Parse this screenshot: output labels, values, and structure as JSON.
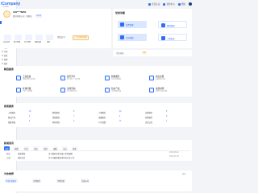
{
  "brand": {
    "logo": "iCompany",
    "sub": "企业服务"
  },
  "sidebar": {
    "items": [
      {
        "label": "首页"
      },
      {
        "label": "我的企业"
      },
      {
        "label": "员工"
      },
      {
        "label": "审批"
      },
      {
        "label": "财务"
      },
      {
        "label": "税务"
      },
      {
        "label": "社保"
      },
      {
        "label": "合同"
      },
      {
        "label": "发票"
      },
      {
        "label": "招聘"
      },
      {
        "label": "服务"
      },
      {
        "label": "设置"
      }
    ]
  },
  "topbar": {
    "items": [
      {
        "label": "企业认证"
      },
      {
        "label": "消息中心"
      },
      {
        "label": "帮助"
      }
    ]
  },
  "profile": {
    "name": "139****8855",
    "desc": "股份有限公司 · 管理员",
    "tag": "已认证",
    "tools": [
      {
        "label": "企业信息"
      },
      {
        "label": "部门管理"
      },
      {
        "label": "员工管理"
      },
      {
        "label": "权限设置"
      },
      {
        "label": "审批"
      }
    ],
    "notice_label": "资质证书",
    "notice_value": "1 个证书即将到期"
  },
  "quick": {
    "title": "常用功能",
    "tiles": [
      {
        "label": "发票管理"
      },
      {
        "label": "费用报销"
      },
      {
        "label": "合同管理"
      },
      {
        "label": "工资发放"
      }
    ],
    "bar_label": "企业动态",
    "bar_badge": "重要"
  },
  "services": {
    "title": "精选服务",
    "items": [
      {
        "name": "工商变更",
        "desc": "快速办理工商业务"
      },
      {
        "name": "银行开户",
        "desc": "对公账户一站办理"
      },
      {
        "name": "财税服务",
        "desc": "专业记账报税"
      },
      {
        "name": "商标注册",
        "desc": "品牌保护专家"
      },
      {
        "name": "社保代缴",
        "desc": "五险一金管理"
      },
      {
        "name": "法律咨询",
        "desc": "专业律师在线"
      },
      {
        "name": "知识产权",
        "desc": "专利软著申请"
      },
      {
        "name": "资质办理",
        "desc": "各类许可证办理"
      }
    ]
  },
  "policies": {
    "title": "政策服务",
    "rows": [
      [
        {
          "k": "工商服务",
          "v": "16"
        },
        {
          "k": "财税服务",
          "v": "8"
        },
        {
          "k": "人事服务",
          "v": "12"
        },
        {
          "k": "法律服务",
          "v": "5"
        }
      ],
      [
        {
          "k": "知识产权",
          "v": "3"
        },
        {
          "k": "资质服务",
          "v": "7"
        },
        {
          "k": "金融服务",
          "v": "4"
        },
        {
          "k": "其他服务",
          "v": "9"
        }
      ],
      [
        {
          "k": "政策补贴",
          "v": "6"
        },
        {
          "k": "科技项目",
          "v": "2"
        },
        {
          "k": "人才政策",
          "v": "11"
        },
        {
          "k": "企业认定",
          "v": "1"
        }
      ]
    ]
  },
  "news": {
    "title": "新闻资讯",
    "chips": [
      {
        "label": "全部"
      },
      {
        "label": "政策"
      },
      {
        "label": "行业"
      },
      {
        "label": "企业"
      },
      {
        "label": "活动"
      },
      {
        "label": "通知"
      },
      {
        "label": "公告"
      },
      {
        "label": "更多"
      }
    ],
    "rows": [
      {
        "a": "北京",
        "b": "创业孵化",
        "c": "关于做好企业年报工作的通知",
        "d": "2023-08-01"
      },
      {
        "a": "上海",
        "b": "高新认定",
        "c": "关于开展高新技术企业认定工作",
        "d": "2023-07-28"
      }
    ]
  },
  "recommend": {
    "title": "为你推荐",
    "more": "更多",
    "items": [
      {
        "label": "企业信用报告"
      },
      {
        "label": "开票服务"
      },
      {
        "label": "代理记账"
      },
      {
        "label": "注册公司"
      }
    ]
  }
}
